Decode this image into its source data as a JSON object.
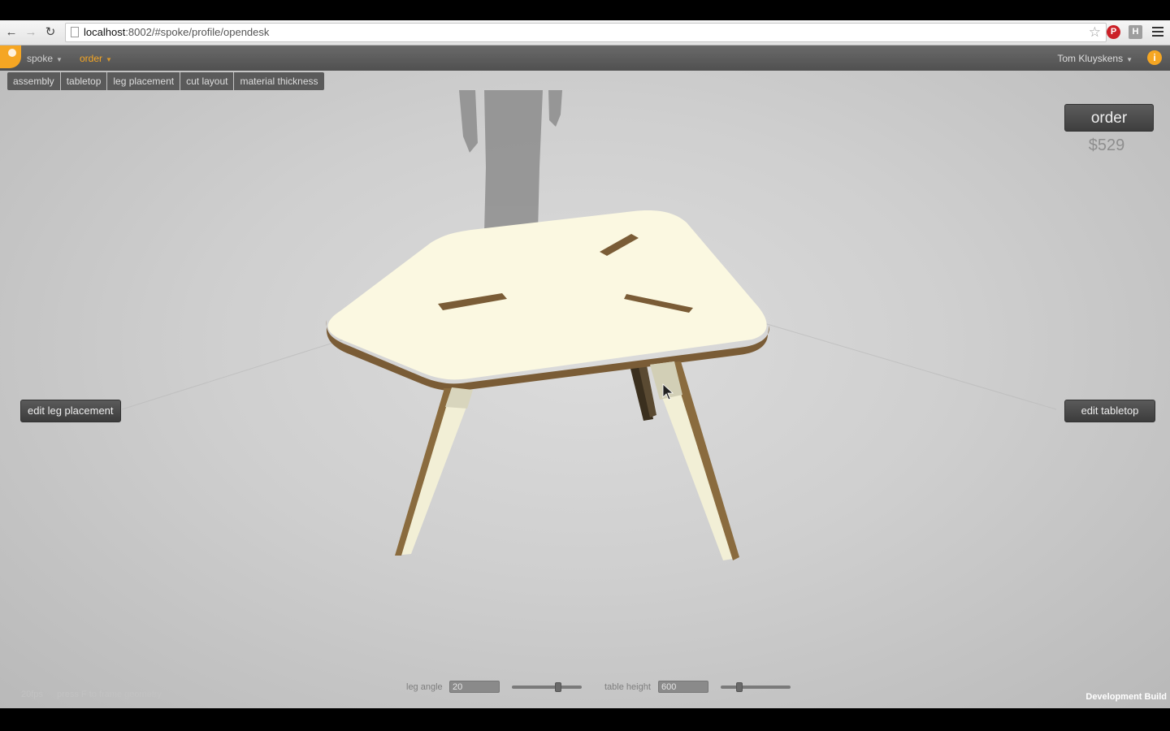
{
  "browser": {
    "url_host": "localhost",
    "url_path": ":8002/#spoke/profile/opendesk"
  },
  "appbar": {
    "menu_spoke": "spoke",
    "menu_order": "order",
    "user": "Tom Kluyskens"
  },
  "tabs": [
    {
      "label": "assembly"
    },
    {
      "label": "tabletop"
    },
    {
      "label": "leg placement"
    },
    {
      "label": "cut layout"
    },
    {
      "label": "material thickness"
    }
  ],
  "order": {
    "button_label": "order",
    "price": "$529"
  },
  "side_buttons": {
    "left": "edit leg placement",
    "right": "edit tabletop"
  },
  "controls": {
    "leg_angle": {
      "label": "leg angle",
      "value": "20",
      "slider_fraction": 0.66
    },
    "table_height": {
      "label": "table height",
      "value": "600",
      "slider_fraction": 0.27
    }
  },
  "footer": {
    "fps": "20fps",
    "hint": "press F to frame geometry",
    "build": "Development Build"
  },
  "colors": {
    "accent": "#f5a623",
    "tabletop": "#fbf8e1",
    "wood_edge": "#6e5230"
  }
}
